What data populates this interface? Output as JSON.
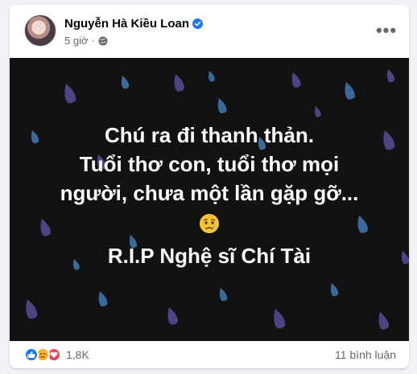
{
  "post": {
    "author": "Nguyễn Hà Kiều Loan",
    "time": "5 giờ",
    "separator": "·",
    "more_label": "•••"
  },
  "image": {
    "background": "#121212",
    "drop_color": "#5b4b9a",
    "drop_color_alt": "#4a90d9",
    "lines": [
      "Chú ra đi thanh thản.",
      "Tuổi thơ con, tuổi thơ mọi",
      "người, chưa một lần gặp gỡ..."
    ],
    "emoji": "crying-face",
    "rip": "R.I.P Nghệ sĩ Chí Tài"
  },
  "footer": {
    "reaction_icons": [
      "like-icon",
      "sad-icon",
      "love-icon"
    ],
    "reaction_count": "1,8K",
    "comments": "11 bình luận"
  },
  "colors": {
    "facebook_blue": "#1877f2",
    "love_red": "#f33e58",
    "sad_yellow": "#f7b125"
  }
}
